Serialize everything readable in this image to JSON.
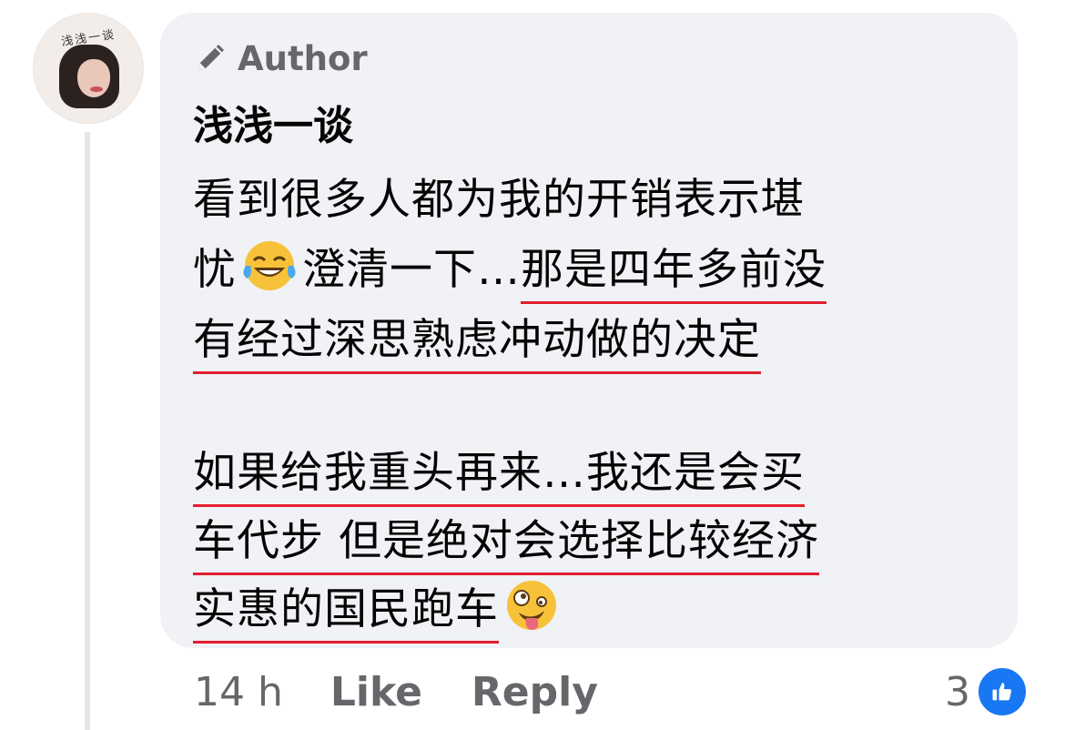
{
  "avatar": {
    "caption": "浅浅一谈"
  },
  "comment": {
    "badge_label": "Author",
    "author_name": "浅浅一谈",
    "lines": {
      "l1": "看到很多人都为我的开销表示堪",
      "l2a": "忧",
      "l2b": "澄清一下…",
      "l2c": "那是四年多前没",
      "l3": "有经过深思熟虑冲动做的决定",
      "l4": "如果给我重头再来…我还是会买",
      "l5": "车代步 但是绝对会选择比较经济",
      "l6": "实惠的国民跑车"
    },
    "emoji": [
      "face-with-tears-of-joy",
      "zany-face"
    ]
  },
  "footer": {
    "time": "14 h",
    "like_label": "Like",
    "reply_label": "Reply",
    "reaction_count": "3",
    "reaction_icon": "thumbs-up-icon",
    "accent": "#1877f2"
  },
  "colors": {
    "bubble": "#f0f2f5",
    "underline": "#e41e30",
    "secondary_text": "#65676b"
  }
}
